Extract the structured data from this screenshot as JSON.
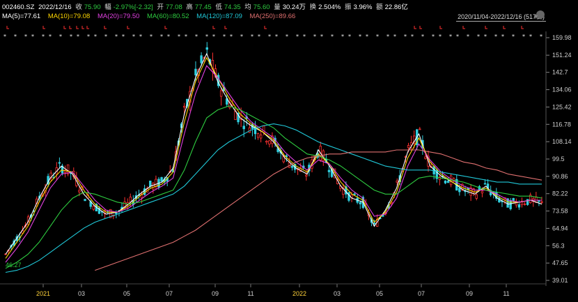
{
  "header": {
    "code": "002460.SZ",
    "date": "2022/12/16",
    "close_label": "收",
    "close_value": "75.90",
    "change_label": "幅",
    "change_value": "-2.97%[-2.32]",
    "open_label": "开",
    "open_value": "77.08",
    "high_label": "高",
    "high_value": "77.45",
    "low_label": "低",
    "low_value": "74.35",
    "avg_label": "均",
    "avg_value": "75.60",
    "volume_label": "量",
    "volume_value": "30.24万",
    "turnover_label": "换",
    "turnover_value": "2.504%",
    "amplitude_label": "振",
    "amplitude_value": "3.96%",
    "amount_label": "额",
    "amount_value": "22.86亿"
  },
  "ma_legend": [
    {
      "text": "MA(5)=77.61",
      "color": "#ffffff"
    },
    {
      "text": "MA(10)=79.08",
      "color": "#ffd700"
    },
    {
      "text": "MA(20)=79.50",
      "color": "#e040e0"
    },
    {
      "text": "MA(60)=80.52",
      "color": "#2ecc40"
    },
    {
      "text": "MA(120)=87.09",
      "color": "#20c8d8"
    },
    {
      "text": "MA(250)=89.66",
      "color": "#e07070"
    }
  ],
  "date_range": "2020/11/04-2022/12/16 (517日)",
  "colors": {
    "up": "#ff3030",
    "down": "#30d0e0",
    "bg": "#000000",
    "axis": "#cccccc"
  },
  "chart_data": {
    "type": "line",
    "title": "",
    "x_tick_labels": [
      "2021",
      "03",
      "05",
      "07",
      "09",
      "11",
      "2022",
      "03",
      "05",
      "07",
      "09",
      "11"
    ],
    "y_tick_labels": [
      "159.98",
      "151.24",
      "142.7",
      "134.06",
      "125.42",
      "116.78",
      "108.14",
      "99.5",
      "90.86",
      "82.22",
      "73.58",
      "64.94",
      "56.3",
      "47.65",
      "39.01"
    ],
    "ylim": [
      39.01,
      159.98
    ],
    "low_annotation": "46.27",
    "series": [
      {
        "name": "MA(5)",
        "color": "#ffffff",
        "values": [
          52,
          60,
          68,
          80,
          90,
          96,
          92,
          82,
          76,
          72,
          73,
          77,
          82,
          86,
          88,
          95,
          122,
          140,
          152,
          138,
          128,
          120,
          116,
          113,
          108,
          100,
          95,
          92,
          104,
          96,
          86,
          80,
          78,
          66,
          74,
          85,
          103,
          112,
          96,
          91,
          88,
          84,
          82,
          86,
          80,
          77,
          78,
          79,
          77
        ]
      },
      {
        "name": "MA(10)",
        "color": "#ffd700",
        "values": [
          50,
          58,
          66,
          78,
          88,
          94,
          93,
          84,
          77,
          73,
          73,
          76,
          81,
          85,
          87,
          93,
          118,
          138,
          150,
          140,
          130,
          122,
          117,
          113,
          109,
          101,
          96,
          93,
          102,
          97,
          88,
          82,
          79,
          68,
          73,
          83,
          100,
          110,
          98,
          92,
          88,
          85,
          83,
          85,
          81,
          78,
          78,
          79,
          79
        ]
      },
      {
        "name": "MA(20)",
        "color": "#e040e0",
        "values": [
          48,
          55,
          63,
          74,
          85,
          92,
          93,
          86,
          79,
          74,
          73,
          75,
          79,
          83,
          86,
          90,
          112,
          132,
          146,
          140,
          132,
          124,
          118,
          114,
          110,
          103,
          98,
          94,
          99,
          97,
          90,
          84,
          80,
          71,
          72,
          80,
          96,
          107,
          99,
          93,
          89,
          86,
          84,
          84,
          82,
          79,
          78,
          79,
          79
        ]
      },
      {
        "name": "MA(60)",
        "color": "#2ecc40",
        "values": [
          45,
          48,
          52,
          58,
          66,
          74,
          80,
          83,
          82,
          80,
          78,
          77,
          78,
          80,
          82,
          84,
          94,
          108,
          120,
          124,
          126,
          124,
          121,
          118,
          115,
          110,
          106,
          102,
          101,
          99,
          96,
          92,
          88,
          84,
          82,
          82,
          86,
          90,
          91,
          90,
          89,
          88,
          86,
          84,
          83,
          82,
          81,
          81,
          80
        ]
      },
      {
        "name": "MA(120)",
        "color": "#20c8d8",
        "values": [
          43,
          44,
          46,
          49,
          53,
          57,
          61,
          65,
          68,
          70,
          72,
          74,
          76,
          78,
          80,
          82,
          86,
          92,
          98,
          104,
          108,
          111,
          114,
          116,
          117,
          116,
          114,
          111,
          108,
          106,
          104,
          102,
          100,
          98,
          96,
          95,
          94,
          94,
          94,
          93,
          92,
          91,
          90,
          89,
          88,
          88,
          87,
          87,
          87
        ]
      },
      {
        "name": "MA(250)",
        "color": "#e07070",
        "values": [
          null,
          null,
          null,
          null,
          null,
          null,
          null,
          null,
          44,
          46,
          48,
          50,
          52,
          54,
          56,
          58,
          61,
          64,
          68,
          72,
          76,
          80,
          84,
          88,
          92,
          95,
          98,
          100,
          101,
          102,
          102,
          103,
          103,
          103,
          103,
          104,
          104,
          104,
          103,
          102,
          100,
          98,
          97,
          95,
          94,
          92,
          91,
          90,
          89
        ]
      }
    ]
  }
}
